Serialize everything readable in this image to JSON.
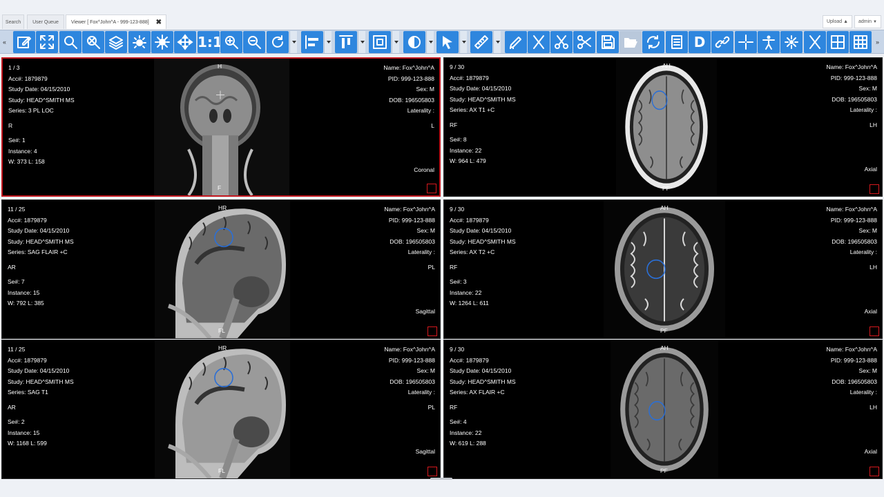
{
  "tabs": [
    {
      "label": "Search"
    },
    {
      "label": "User Queue"
    },
    {
      "label": "Viewer [ Fox^John^A - 999-123-888]",
      "close": "✖"
    }
  ],
  "header": {
    "upload_label": "Upload",
    "user_label": "admin"
  },
  "toolbar": {
    "tools": [
      {
        "name": "annotate-edit-tool",
        "icon": "pencil-square-icon"
      },
      {
        "name": "fit-to-window-tool",
        "icon": "expand-arrows-icon"
      },
      {
        "name": "magnify-tool",
        "icon": "magnifier-icon"
      },
      {
        "name": "reset-zoom-tool",
        "icon": "zoom-cancel-icon"
      },
      {
        "name": "stack-scroll-tool",
        "icon": "layers-icon"
      },
      {
        "name": "window-level-tool",
        "icon": "brightness-icon"
      },
      {
        "name": "auto-window-tool",
        "icon": "auto-adjust-icon"
      },
      {
        "name": "pan-tool",
        "icon": "move-arrows-icon"
      },
      {
        "name": "actual-size-tool",
        "icon": "one-to-one-icon",
        "text": "1:1"
      },
      {
        "name": "zoom-in-tool",
        "icon": "zoom-in-icon"
      },
      {
        "name": "zoom-out-tool",
        "icon": "zoom-out-icon"
      },
      {
        "name": "rotate-tool",
        "icon": "rotate-icon"
      },
      {
        "name": "align-tool",
        "icon": "align-left-icon"
      },
      {
        "name": "align-top-tool",
        "icon": "align-top-icon"
      },
      {
        "name": "layout-tool",
        "icon": "layout-box-icon"
      },
      {
        "name": "invert-tool",
        "icon": "contrast-icon"
      },
      {
        "name": "pointer-tool",
        "icon": "cursor-arrow-icon"
      },
      {
        "name": "ruler-tool",
        "icon": "ruler-icon"
      },
      {
        "name": "annotation-pen-tool",
        "icon": "pen-draw-icon"
      },
      {
        "name": "cut-tool",
        "icon": "scissors-icon"
      },
      {
        "name": "scissors-split-tool",
        "icon": "scissors-cut-icon"
      },
      {
        "name": "scissors-clip-tool",
        "icon": "scissors-clip-icon"
      },
      {
        "name": "save-tool",
        "icon": "floppy-disk-icon"
      },
      {
        "name": "open-tool",
        "icon": "folder-open-icon"
      },
      {
        "name": "refresh-tool",
        "icon": "refresh-icon"
      },
      {
        "name": "report-tool",
        "icon": "document-list-icon"
      },
      {
        "name": "dicom-tool",
        "icon": "letter-d-icon",
        "text": "D"
      },
      {
        "name": "link-tool",
        "icon": "link-chain-icon"
      },
      {
        "name": "crosshair-tool",
        "icon": "crosshair-icon"
      },
      {
        "name": "person-tool",
        "icon": "person-icon"
      },
      {
        "name": "settings-tool",
        "icon": "gear-person-icon"
      },
      {
        "name": "clear-tool",
        "icon": "clear-cross-icon"
      },
      {
        "name": "grid-2x2-tool",
        "icon": "grid-2x2-icon"
      },
      {
        "name": "grid-3x3-tool",
        "icon": "grid-3x3-icon"
      }
    ]
  },
  "viewports": [
    {
      "image_index": "1 / 3",
      "acc": "Acc#: 1879879",
      "study_date": "Study Date: 04/15/2010",
      "study": "Study: HEAD^SMITH MS",
      "series": "Series: 3 PL LOC",
      "side_left": "R",
      "se": "Se#: 1",
      "instance": "Instance: 4",
      "wl": "W: 373 L: 158",
      "name": "Name: Fox^John^A",
      "pid": "PID: 999-123-888",
      "sex": "Sex: M",
      "dob": "DOB: 196505803",
      "laterality": "Laterality :",
      "side_right": "L",
      "orientation": "Coronal",
      "top_marker": "H",
      "bottom_marker": "F",
      "scan_type": "coronal",
      "selected": true
    },
    {
      "image_index": "9 / 30",
      "acc": "Acc#: 1879879",
      "study_date": "Study Date: 04/15/2010",
      "study": "Study: HEAD^SMITH MS",
      "series": "Series: AX T1 +C",
      "side_left": "RF",
      "se": "Se#: 8",
      "instance": "Instance: 22",
      "wl": "W: 964 L: 479",
      "name": "Name: Fox^John^A",
      "pid": "PID: 999-123-888",
      "sex": "Sex: M",
      "dob": "DOB: 196505803",
      "laterality": "Laterality :",
      "side_right": "LH",
      "orientation": "Axial",
      "top_marker": "AH",
      "bottom_marker": "PF",
      "scan_type": "axial-t1"
    },
    {
      "image_index": "11 / 25",
      "acc": "Acc#: 1879879",
      "study_date": "Study Date: 04/15/2010",
      "study": "Study: HEAD^SMITH MS",
      "series": "Series: SAG FLAIR +C",
      "side_left": "AR",
      "se": "Se#: 7",
      "instance": "Instance: 15",
      "wl": "W: 792 L: 385",
      "name": "Name: Fox^John^A",
      "pid": "PID: 999-123-888",
      "sex": "Sex: M",
      "dob": "DOB: 196505803",
      "laterality": "Laterality :",
      "side_right": "PL",
      "orientation": "Sagittal",
      "top_marker": "HR",
      "bottom_marker": "FL",
      "scan_type": "sag-flair"
    },
    {
      "image_index": "9 / 30",
      "acc": "Acc#: 1879879",
      "study_date": "Study Date: 04/15/2010",
      "study": "Study: HEAD^SMITH MS",
      "series": "Series: AX T2 +C",
      "side_left": "RF",
      "se": "Se#: 3",
      "instance": "Instance: 22",
      "wl": "W: 1264 L: 611",
      "name": "Name: Fox^John^A",
      "pid": "PID: 999-123-888",
      "sex": "Sex: M",
      "dob": "DOB: 196505803",
      "laterality": "Laterality :",
      "side_right": "LH",
      "orientation": "Axial",
      "top_marker": "AH",
      "bottom_marker": "PF",
      "scan_type": "axial-t2"
    },
    {
      "image_index": "11 / 25",
      "acc": "Acc#: 1879879",
      "study_date": "Study Date: 04/15/2010",
      "study": "Study: HEAD^SMITH MS",
      "series": "Series: SAG T1",
      "side_left": "AR",
      "se": "Se#: 2",
      "instance": "Instance: 15",
      "wl": "W: 1168 L: 599",
      "name": "Name: Fox^John^A",
      "pid": "PID: 999-123-888",
      "sex": "Sex: M",
      "dob": "DOB: 196505803",
      "laterality": "Laterality :",
      "side_right": "PL",
      "orientation": "Sagittal",
      "top_marker": "HR",
      "bottom_marker": "FL",
      "scan_type": "sag-t1"
    },
    {
      "image_index": "9 / 30",
      "acc": "Acc#: 1879879",
      "study_date": "Study Date: 04/15/2010",
      "study": "Study: HEAD^SMITH MS",
      "series": "Series: AX FLAIR +C",
      "side_left": "RF",
      "se": "Se#: 4",
      "instance": "Instance: 22",
      "wl": "W: 619 L: 288",
      "name": "Name: Fox^John^A",
      "pid": "PID: 999-123-888",
      "sex": "Sex: M",
      "dob": "DOB: 196505803",
      "laterality": "Laterality :",
      "side_right": "LH",
      "orientation": "Axial",
      "top_marker": "AH",
      "bottom_marker": "PF",
      "scan_type": "axial-flair"
    }
  ],
  "colors": {
    "toolbar_button": "#2e86de",
    "selected_border": "#c3171f",
    "marker": "#d6191e",
    "roi_circle": "#2b6fd6"
  }
}
